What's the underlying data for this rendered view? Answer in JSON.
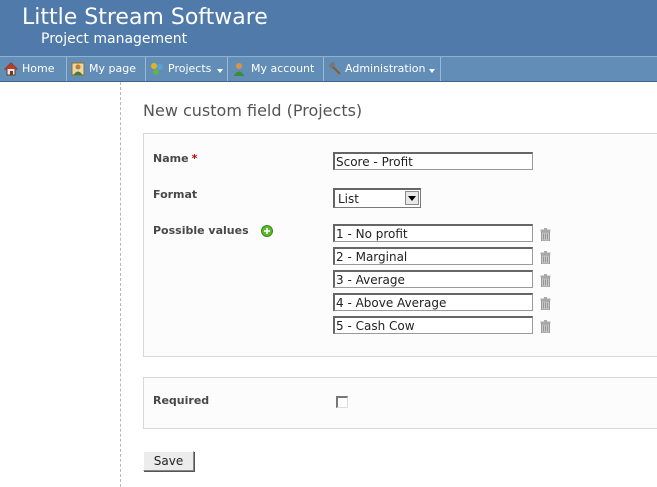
{
  "header": {
    "title": "Little Stream Software",
    "subtitle": "Project management"
  },
  "menu": {
    "items": [
      {
        "label": "Home",
        "icon": "home-icon",
        "dropdown": false
      },
      {
        "label": "My page",
        "icon": "user-page-icon",
        "dropdown": false
      },
      {
        "label": "Projects",
        "icon": "projects-icon",
        "dropdown": true
      },
      {
        "label": "My account",
        "icon": "account-icon",
        "dropdown": false
      },
      {
        "label": "Administration",
        "icon": "hammer-icon",
        "dropdown": true
      }
    ]
  },
  "page": {
    "title": "New custom field (Projects)"
  },
  "form": {
    "name_label": "Name",
    "required_star": "*",
    "name_value": "Score - Profit",
    "format_label": "Format",
    "format_value": "List",
    "possible_values_label": "Possible values",
    "possible_values": [
      "1 - No profit",
      "2 - Marginal",
      "3 - Average",
      "4 - Above Average",
      "5 - Cash Cow"
    ],
    "required_label": "Required",
    "required_checked": false,
    "save_label": "Save"
  },
  "colors": {
    "header_bg": "#507aaa",
    "menu_bg": "#628db6",
    "required_star": "#bb0000",
    "add_icon": "#5cb82e"
  }
}
